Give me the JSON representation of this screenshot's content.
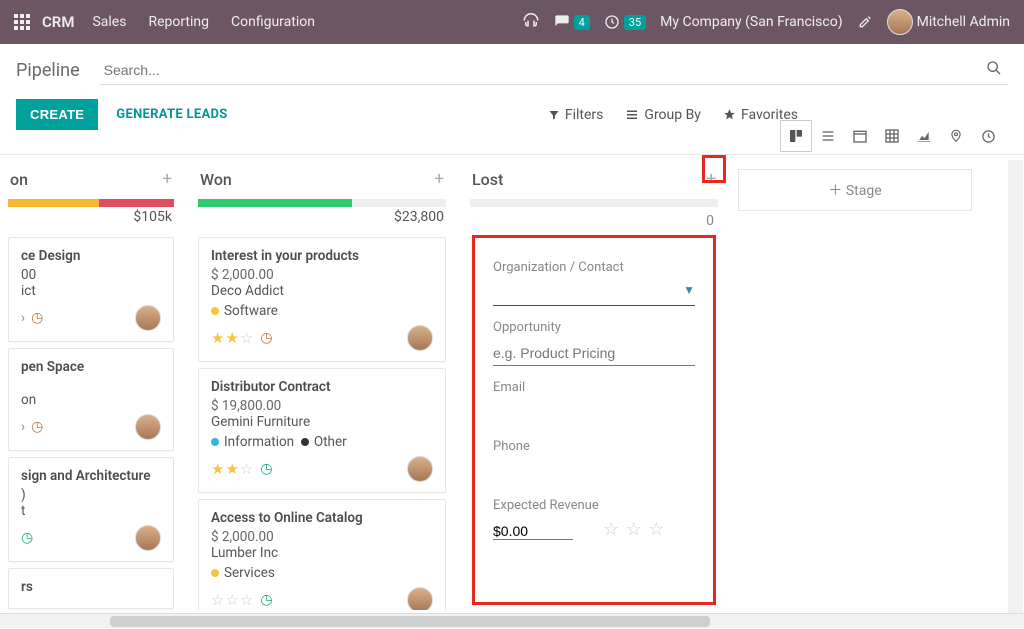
{
  "navbar": {
    "brand": "CRM",
    "items": [
      "Sales",
      "Reporting",
      "Configuration"
    ],
    "msg_count": "4",
    "timer_count": "35",
    "company": "My Company (San Francisco)",
    "user": "Mitchell Admin"
  },
  "page": {
    "title": "Pipeline",
    "create": "CREATE",
    "generate": "GENERATE LEADS",
    "search_placeholder": "Search...",
    "filters": "Filters",
    "groupby": "Group By",
    "favorites": "Favorites",
    "add_stage": "Stage"
  },
  "stages": {
    "first": {
      "title": "on",
      "total": "$105k",
      "cards": [
        {
          "title": "ce Design",
          "l2": "00",
          "l3": "ict"
        },
        {
          "title": "pen Space",
          "l2": "",
          "l3": "on"
        },
        {
          "title": "sign and Architecture",
          "l2": ")",
          "l3": "t"
        },
        {
          "title": "rs"
        }
      ]
    },
    "won": {
      "title": "Won",
      "total": "$23,800",
      "cards": [
        {
          "title": "Interest in your products",
          "amount": "$ 2,000.00",
          "company": "Deco Addict",
          "tag": "Software"
        },
        {
          "title": "Distributor Contract",
          "amount": "$ 19,800.00",
          "company": "Gemini Furniture",
          "tag1": "Information",
          "tag2": "Other"
        },
        {
          "title": "Access to Online Catalog",
          "amount": "$ 2,000.00",
          "company": "Lumber Inc",
          "tag": "Services"
        }
      ]
    },
    "lost": {
      "title": "Lost",
      "zero": "0"
    }
  },
  "form": {
    "org_label": "Organization / Contact",
    "opp_label": "Opportunity",
    "opp_placeholder": "e.g. Product Pricing",
    "email_label": "Email",
    "phone_label": "Phone",
    "revenue_label": "Expected Revenue",
    "revenue_value": "$0.00"
  }
}
